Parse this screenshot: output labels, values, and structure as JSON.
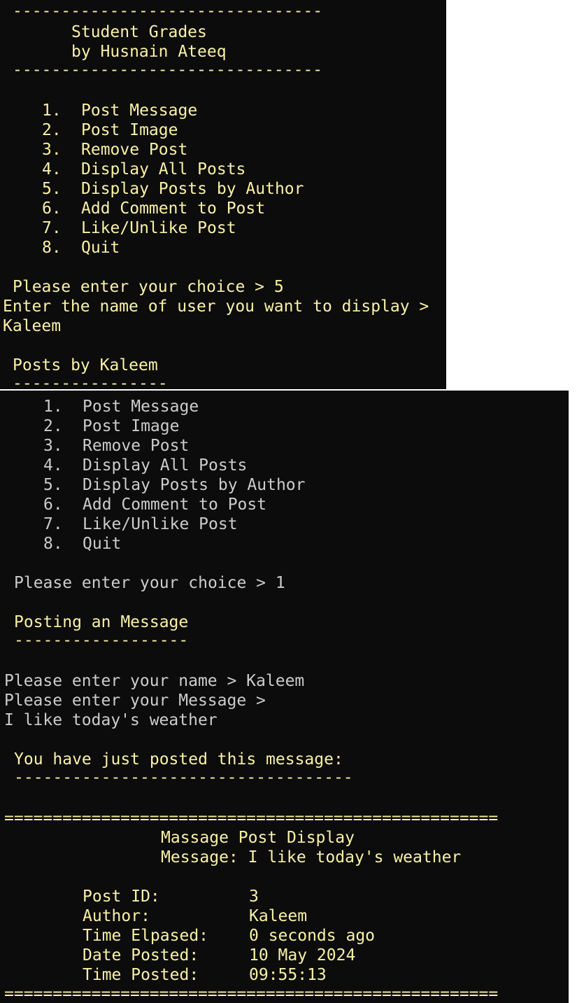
{
  "colors": {
    "background": "#0c0c0c",
    "yellow_text": "#f9f1a5",
    "gray_text": "#cccccc"
  },
  "top_terminal": {
    "header_rule_top": "--------------------------------",
    "title": "Student Grades",
    "author_line": "by Husnain Ateeq",
    "header_rule_bottom": "--------------------------------",
    "menu": [
      {
        "num": "1.",
        "label": "Post Message"
      },
      {
        "num": "2.",
        "label": "Post Image"
      },
      {
        "num": "3.",
        "label": "Remove Post"
      },
      {
        "num": "4.",
        "label": "Display All Posts"
      },
      {
        "num": "5.",
        "label": "Display Posts by Author"
      },
      {
        "num": "6.",
        "label": "Add Comment to Post"
      },
      {
        "num": "7.",
        "label": "Like/Unlike Post"
      },
      {
        "num": "8.",
        "label": "Quit"
      }
    ],
    "choice_prompt": "Please enter your choice > 5",
    "user_prompt": "Enter the name of user you want to display >",
    "user_input": "Kaleem",
    "posts_by_heading": "Posts by Kaleem",
    "posts_by_rule": "----------------"
  },
  "bottom_terminal": {
    "menu": [
      {
        "num": "1.",
        "label": "Post Message"
      },
      {
        "num": "2.",
        "label": "Post Image"
      },
      {
        "num": "3.",
        "label": "Remove Post"
      },
      {
        "num": "4.",
        "label": "Display All Posts"
      },
      {
        "num": "5.",
        "label": "Display Posts by Author"
      },
      {
        "num": "6.",
        "label": "Add Comment to Post"
      },
      {
        "num": "7.",
        "label": "Like/Unlike Post"
      },
      {
        "num": "8.",
        "label": "Quit"
      }
    ],
    "choice_prompt": "Please enter your choice > 1",
    "posting_heading": "Posting an Message",
    "posting_rule": "------------------",
    "name_prompt": "Please enter your name > Kaleem",
    "message_prompt": "Please enter your Message >",
    "message_input": "I like today's weather",
    "posted_heading": "You have just posted this message:",
    "posted_rule": "-----------------------------------",
    "display_rule_top": "===================================================",
    "display_title": "Massage Post Display",
    "display_message": "Message: I like today's weather",
    "fields": [
      {
        "label": "Post ID:",
        "value": "3"
      },
      {
        "label": "Author:",
        "value": "Kaleem"
      },
      {
        "label": "Time Elpased:",
        "value": "0 seconds ago"
      },
      {
        "label": "Date Posted:",
        "value": "10 May 2024"
      },
      {
        "label": "Time Posted:",
        "value": "09:55:13"
      }
    ],
    "display_rule_bottom": "==================================================="
  }
}
